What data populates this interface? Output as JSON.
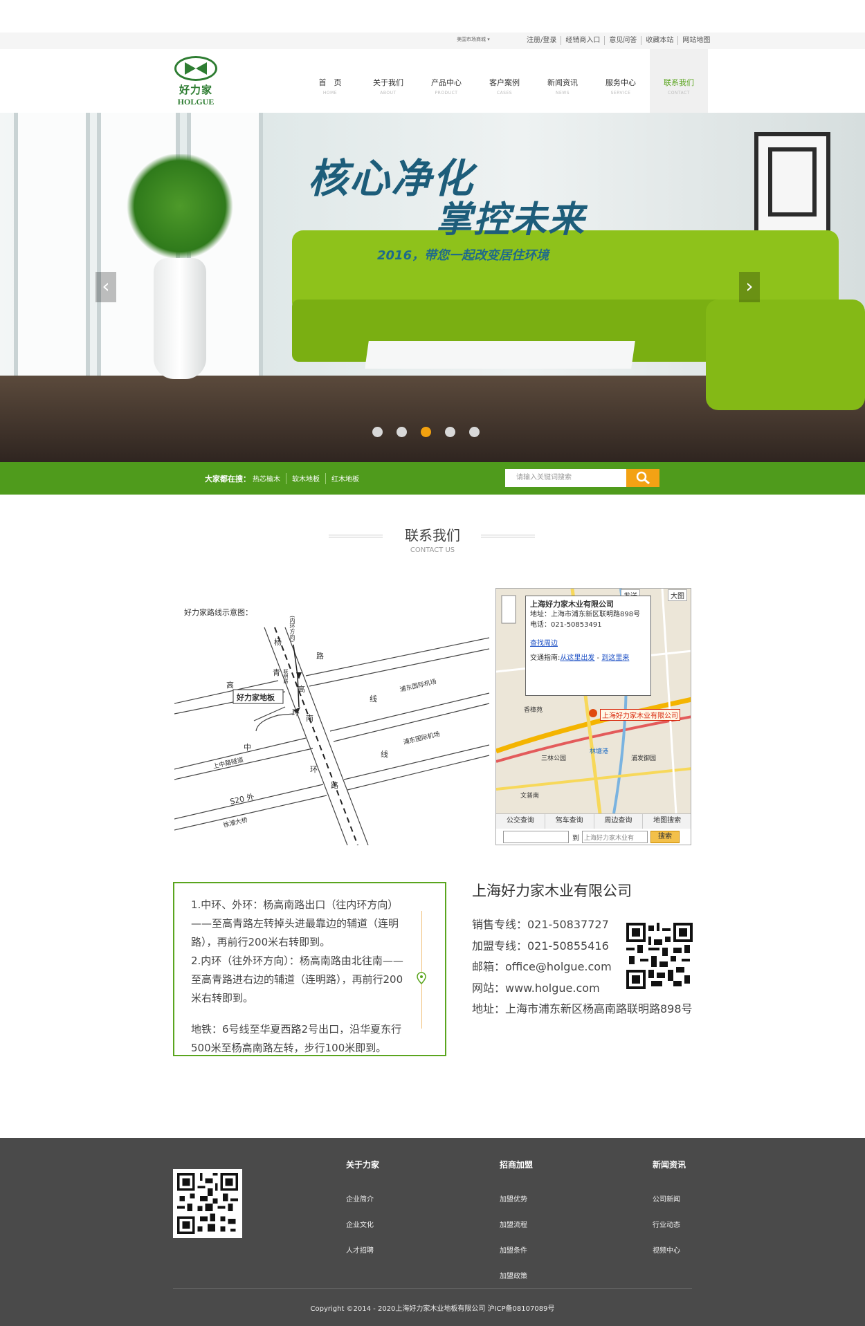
{
  "topbar": {
    "region": "美国市场商城",
    "links": [
      "注册/登录",
      "经销商入口",
      "意见问答",
      "收藏本站",
      "网站地图"
    ]
  },
  "logo": {
    "cn": "好力家",
    "en": "HOLGUE"
  },
  "nav": [
    {
      "cn": "首　页",
      "en": "HOME"
    },
    {
      "cn": "关于我们",
      "en": "ABOUT"
    },
    {
      "cn": "产品中心",
      "en": "PRODUCT"
    },
    {
      "cn": "客户案例",
      "en": "CASES"
    },
    {
      "cn": "新闻资讯",
      "en": "NEWS"
    },
    {
      "cn": "服务中心",
      "en": "SERVICE"
    },
    {
      "cn": "联系我们",
      "en": "CONTACT"
    }
  ],
  "banner": {
    "line1": "核心净化",
    "line2": "掌控未来",
    "line3": "2016，带您一起改变居住环境",
    "prev": "‹",
    "next": "›",
    "active_dot": 3,
    "dot_count": 5
  },
  "search": {
    "hot_label": "大家都在搜：",
    "hot_terms": [
      "热芯榆木",
      "软木地板",
      "红木地板"
    ],
    "placeholder": "请输入关键词搜索"
  },
  "section": {
    "title": "联系我们",
    "subtitle": "CONTACT US"
  },
  "route": {
    "caption": "好力家路线示意图：",
    "labels": {
      "yang": "杨",
      "gao": "高",
      "nan": "南",
      "lu": "路",
      "inner": "(内环方向)",
      "gaoqing": "高",
      "qing": "青",
      "xian": "线",
      "zhong": "中",
      "huan": "环",
      "s20": "S20 外",
      "huan2": "环",
      "lu2": "路",
      "store": "好力家地板",
      "pudong1": "浦东国际机场",
      "pudong2": "浦东国际机场",
      "tunnel": "上中路隧道",
      "bridge": "徐浦大桥",
      "lianming": "联明路"
    }
  },
  "map": {
    "company": "上海好力家木业有限公司",
    "address": "地址：上海市浦东新区联明路898号",
    "phone": "电话：021-50853491",
    "nearby": "查找周边",
    "traffic_label": "交通指南:",
    "from_here": "从这里出发",
    "to_here": "到这里来",
    "marker": "上海好力家木业有限公司",
    "send": "发送",
    "bigmap": "大图",
    "places": [
      "香樟苑",
      "三林公园",
      "林塘港",
      "浦发御园",
      "文普南"
    ],
    "tabs": [
      "公交查询",
      "驾车查询",
      "周边查询",
      "地图搜索"
    ],
    "to": "到",
    "to_placeholder": "上海好力家木业有",
    "search_btn": "搜索"
  },
  "directions": {
    "p1": "1.中环、外环：杨高南路出口（往内环方向）——至高青路左转掉头进最靠边的辅道（连明路），再前行200米右转即到。",
    "p2": "2.内环（往外环方向）：杨高南路由北往南——至高青路进右边的辅道（连明路），再前行200米右转即到。",
    "p3": "地铁：6号线至华夏西路2号出口，沿华夏东行500米至杨高南路左转，步行100米即到。"
  },
  "company": {
    "name": "上海好力家木业有限公司",
    "sales": "销售专线：021-50837727",
    "join": "加盟专线：021-50855416",
    "email": "邮箱：office@holgue.com",
    "site": "网站：www.holgue.com",
    "address": "地址：上海市浦东新区杨高南路联明路898号"
  },
  "footer": {
    "cols": [
      {
        "title": "关于力家",
        "links": [
          "企业简介",
          "企业文化",
          "人才招聘"
        ]
      },
      {
        "title": "招商加盟",
        "links": [
          "加盟优势",
          "加盟流程",
          "加盟条件",
          "加盟政策"
        ]
      },
      {
        "title": "新闻资讯",
        "links": [
          "公司新闻",
          "行业动态",
          "视频中心"
        ]
      }
    ],
    "copyright": "Copyright ©2014 - 2020上海好力家木业地板有限公司  沪ICP备08107089号"
  },
  "colors": {
    "brand": "#4f9b1c",
    "accent": "#f3a214",
    "nav_active": "#5aa51e",
    "footer": "#4a4a4a"
  }
}
